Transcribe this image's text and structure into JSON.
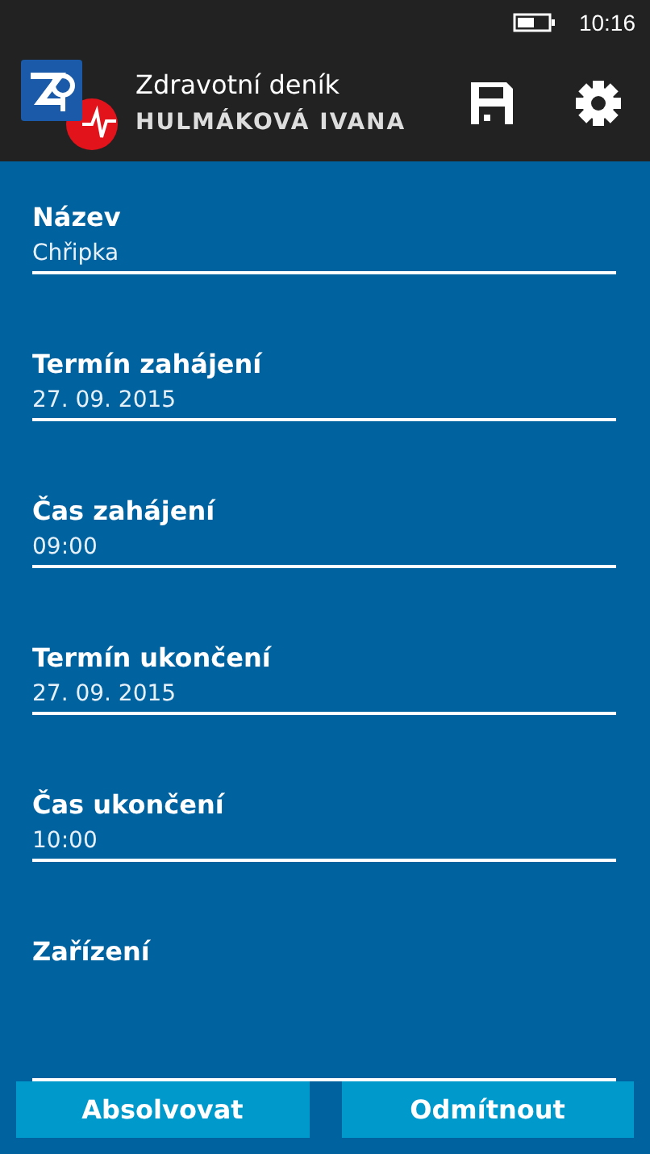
{
  "status_bar": {
    "time": "10:16"
  },
  "header": {
    "app_title": "Zdravotní deník",
    "user_name": "HULMÁKOVÁ IVANA"
  },
  "fields": [
    {
      "label": "Název",
      "value": "Chřipka"
    },
    {
      "label": "Termín zahájení",
      "value": "27. 09. 2015"
    },
    {
      "label": "Čas zahájení",
      "value": "09:00"
    },
    {
      "label": "Termín ukončení",
      "value": "27. 09. 2015"
    },
    {
      "label": "Čas ukončení",
      "value": "10:00"
    },
    {
      "label": "Zařízení"
    }
  ],
  "buttons": [
    "Absolvovat",
    "Odmítnout"
  ]
}
